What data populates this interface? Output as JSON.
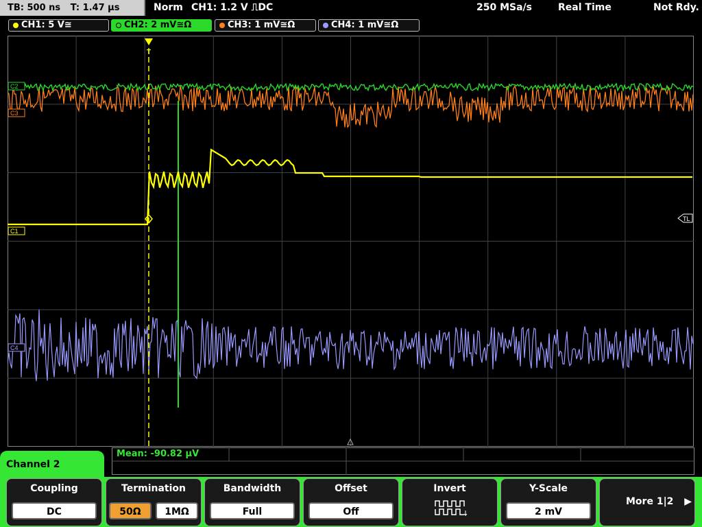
{
  "topbar": {
    "timebase": "TB: 500 ns",
    "trigger_time": "T: 1.47 µs",
    "mode": "Norm",
    "trigger_info": "CH1: 1.2 V ⎍DC",
    "sample_rate": "250 MSa/s",
    "acq_mode": "Real Time",
    "status": "Not Rdy."
  },
  "channels": [
    {
      "label": "CH1: 5 V≅",
      "color": "#ffff00"
    },
    {
      "label": "CH2: 2 mV≅Ω",
      "color": "#2bd92b"
    },
    {
      "label": "CH3: 1 mV≅Ω",
      "color": "#ff7f1a"
    },
    {
      "label": "CH4: 1 mV≅Ω",
      "color": "#9a9aff"
    }
  ],
  "markers": {
    "c2": "C2",
    "c3": "C3",
    "c1": "C1",
    "c4": "C4",
    "tl": "TL",
    "trigger": "T"
  },
  "measurement": {
    "text": "Mean: -90.82 µV"
  },
  "menu": {
    "title": "Channel 2",
    "softkeys": [
      {
        "title": "Coupling",
        "value": "DC"
      },
      {
        "title": "Termination",
        "option_a": "50Ω",
        "option_b": "1MΩ",
        "active": "50Ω"
      },
      {
        "title": "Bandwidth",
        "value": "Full"
      },
      {
        "title": "Offset",
        "value": "Off"
      },
      {
        "title": "Invert",
        "icon": "invert-waveform-icon"
      },
      {
        "title": "Y-Scale",
        "value": "2 mV"
      },
      {
        "title": "More 1|2",
        "icon": "arrow-right-icon"
      }
    ]
  },
  "colors": {
    "ch1": "#ffff00",
    "ch2": "#2bd92b",
    "ch3": "#ff7f1a",
    "ch4": "#9a9aff",
    "menu_accent": "#35e635",
    "active_option": "#f0a030"
  }
}
